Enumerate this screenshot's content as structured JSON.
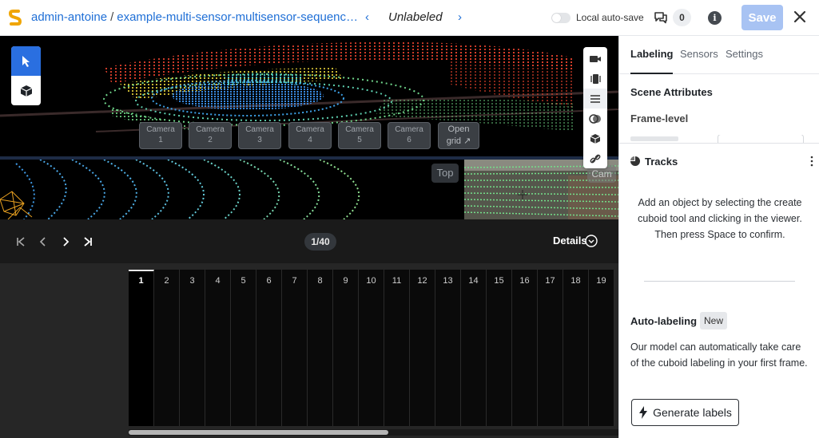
{
  "header": {
    "workspace": "admin-antoine",
    "separator": "/",
    "dataset": "example-multi-sensor-multisensor-sequenc…",
    "prev_arrow": "‹",
    "next_arrow": "›",
    "status": "Unlabeled",
    "autosave_label": "Local auto-save",
    "autosave_on": false,
    "comment_count": "0",
    "info_glyph": "i",
    "save_label": "Save"
  },
  "viewer": {
    "cameras": [
      {
        "label": "Camera",
        "num": "1"
      },
      {
        "label": "Camera",
        "num": "2"
      },
      {
        "label": "Camera",
        "num": "3"
      },
      {
        "label": "Camera",
        "num": "4"
      },
      {
        "label": "Camera",
        "num": "5"
      },
      {
        "label": "Camera",
        "num": "6"
      }
    ],
    "open_grid_line1": "Open",
    "open_grid_line2": "grid",
    "top_label": "Top",
    "cam_label": "Cam",
    "left_tools": [
      "pointer-icon",
      "cuboid-icon"
    ],
    "right_tools": [
      "camera-icon",
      "images-icon",
      "list-icon",
      "overlap-icon",
      "box-icon",
      "link-icon"
    ]
  },
  "timeline": {
    "frame_indicator": "1/40",
    "details_label": "Details",
    "frames": [
      "1",
      "2",
      "3",
      "4",
      "5",
      "6",
      "7",
      "8",
      "9",
      "10",
      "11",
      "12",
      "13",
      "14",
      "15",
      "16",
      "17",
      "18",
      "19"
    ],
    "current_frame": "1"
  },
  "panel": {
    "tabs": [
      "Labeling",
      "Sensors",
      "Settings"
    ],
    "active_tab": "Labeling",
    "scene_attributes": "Scene Attributes",
    "frame_level": "Frame-level",
    "tracks_title": "Tracks",
    "empty_message": "Add an object by selecting the create cuboid tool and clicking in the viewer. Then press Space to confirm.",
    "autolabel_title": "Auto-labeling",
    "new_badge": "New",
    "autolabel_desc": "Our model can automatically take care of the cuboid labeling in your first frame.",
    "generate_label": "Generate labels"
  },
  "colors": {
    "accent": "#2a6fe0",
    "link": "#1f6fd6",
    "save_disabled": "#a8c3f3"
  }
}
